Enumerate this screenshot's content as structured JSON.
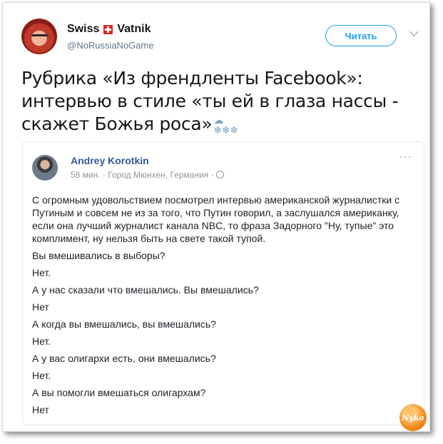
{
  "tweet": {
    "author_name_1": "Swiss",
    "author_name_2": "Vatnik",
    "author_flag_icon": "swiss-flag-icon",
    "handle": "@NoRussiaNoGame",
    "follow_label": "Читать",
    "text": "Рубрика «Из френдленты Facebook»: интервью в стиле «ты ей в глаза нассы - скажет Божья роса»",
    "emoji_icon": "snow-cloud-icon",
    "accent_color": "#1da1f2"
  },
  "quoted_post": {
    "author": "Andrey Korotkin",
    "meta": "58 мин. · Город Мюнхен, Германия ·",
    "privacy_icon": "globe-icon",
    "menu_label": "···",
    "paragraph": "С огромным удовольствием посмотрел интервью американской журналистки с Путиным и совсем не из за того, что Путин говорил, а заслушался американку, если она лучший журналист канала NBC, то фраза Задорного \"Ну, тупые\" это комплимент, ну нельзя быть на свете такой тупой.",
    "lines": [
      "Вы вмешивались в выборы?",
      "Нет.",
      "А у нас сказали что вмешались. Вы вмешались?",
      "Нет",
      "А когда вы вмешались, вы вмешались?",
      "Нет.",
      "А у вас олигархи есть, они вмешались?",
      "Нет.",
      "А вы помогли вмешаться олигархам?",
      "Нет"
    ],
    "name_color": "#365899"
  },
  "watermark": {
    "label": "Nyka"
  }
}
